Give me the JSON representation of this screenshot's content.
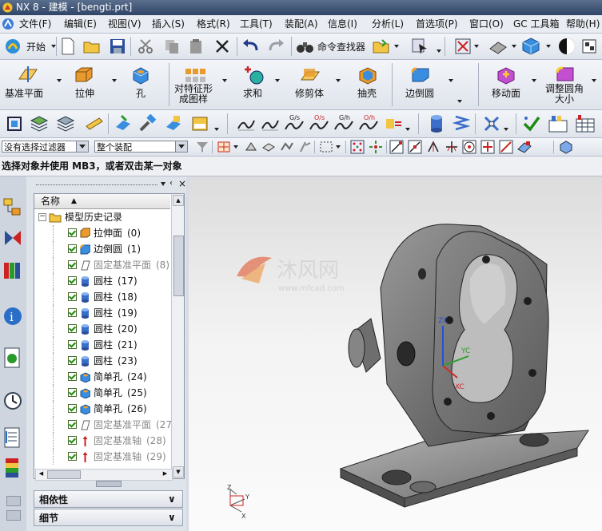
{
  "window": {
    "title": "NX 8 - 建模 - [bengti.prt]"
  },
  "menu": [
    "文件(F)",
    "编辑(E)",
    "视图(V)",
    "插入(S)",
    "格式(R)",
    "工具(T)",
    "装配(A)",
    "信息(I)",
    "分析(L)",
    "首选项(P)",
    "窗口(O)",
    "GC 工具箱",
    "帮助(H)"
  ],
  "toolbar1": {
    "start_label": "开始",
    "command_finder_label": "命令查找器"
  },
  "feature_toolbar": {
    "datum_plane": "基准平面",
    "extrude": "拉伸",
    "hole": "孔",
    "pattern_line1": "对特征形",
    "pattern_line2": "成图样",
    "unite": "求和",
    "trim_body": "修剪体",
    "shell": "抽壳",
    "edge_blend": "边倒圆",
    "move_face": "移动面",
    "resize_blend_line1": "调整圆角",
    "resize_blend_line2": "大小"
  },
  "selection": {
    "filter_value": "没有选择过滤器",
    "scope_value": "整个装配"
  },
  "status": {
    "prompt": "选择对象并使用 MB3，或者双击某一对象"
  },
  "navigator": {
    "column_name": "名称",
    "root": "模型历史记录",
    "items": [
      {
        "name": "拉伸面",
        "id": "(0)",
        "icon": "extrude-face-icon",
        "greyed": false
      },
      {
        "name": "边倒圆",
        "id": "(1)",
        "icon": "edge-blend-icon",
        "greyed": false
      },
      {
        "name": "固定基准平面",
        "id": "(8)",
        "icon": "datum-plane-icon",
        "greyed": true
      },
      {
        "name": "圆柱",
        "id": "(17)",
        "icon": "cylinder-icon",
        "greyed": false
      },
      {
        "name": "圆柱",
        "id": "(18)",
        "icon": "cylinder-icon",
        "greyed": false
      },
      {
        "name": "圆柱",
        "id": "(19)",
        "icon": "cylinder-icon",
        "greyed": false
      },
      {
        "name": "圆柱",
        "id": "(20)",
        "icon": "cylinder-icon",
        "greyed": false
      },
      {
        "name": "圆柱",
        "id": "(21)",
        "icon": "cylinder-icon",
        "greyed": false
      },
      {
        "name": "圆柱",
        "id": "(23)",
        "icon": "cylinder-icon",
        "greyed": false
      },
      {
        "name": "简单孔",
        "id": "(24)",
        "icon": "simple-hole-icon",
        "greyed": false
      },
      {
        "name": "简单孔",
        "id": "(25)",
        "icon": "simple-hole-icon",
        "greyed": false
      },
      {
        "name": "简单孔",
        "id": "(26)",
        "icon": "simple-hole-icon",
        "greyed": false
      },
      {
        "name": "固定基准平面",
        "id": "(27)",
        "icon": "datum-plane-icon",
        "greyed": true
      },
      {
        "name": "固定基准轴",
        "id": "(28)",
        "icon": "datum-axis-icon",
        "greyed": true
      },
      {
        "name": "固定基准轴",
        "id": "(29)",
        "icon": "datum-axis-icon",
        "greyed": true
      }
    ],
    "dependencies_label": "相依性",
    "details_label": "细节"
  },
  "watermark": {
    "brand": "沐风网",
    "url": "www.mfcad.com"
  },
  "triad": {
    "z": "Z",
    "y": "Y",
    "x": "X",
    "zc": "ZC",
    "yc": "YC",
    "xc": "XC"
  },
  "colors": {
    "titlebar": "#3a4f72",
    "accent_green": "#1c8a10",
    "model_grey": "#6e6e6e"
  }
}
